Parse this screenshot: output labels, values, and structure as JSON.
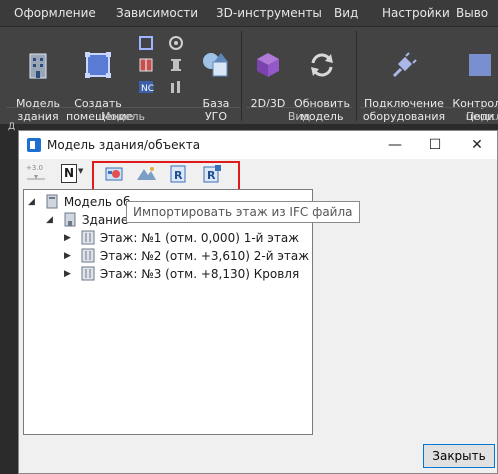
{
  "menu": [
    "Оформление",
    "Зависимости",
    "3D-инструменты",
    "Вид",
    "Настройки",
    "Выво"
  ],
  "ribbon": {
    "model_building": "Модель\nздания",
    "create_room": "Создать\nпомещение",
    "base_ugo": "База\nУГО",
    "view_2d3d": "2D/3D",
    "refresh_model": "Обновить\nмодель",
    "connect_equipment": "Подключение\nоборудования",
    "control_points": "Контроль\nцепи",
    "group_model": "Модель",
    "group_view": "Вид",
    "group_conn": "Подкл",
    "tab_left_glyph": "Д"
  },
  "dialog": {
    "title": "Модель здания/объекта",
    "minimize": "—",
    "maximize": "☐",
    "close": "✕",
    "close_button": "Закрыть",
    "tooltip": "Импортировать этаж из IFC файла",
    "tree": {
      "root": "Модель об",
      "building": "Здание",
      "floors": [
        "Этаж: №1 (отм. 0,000) 1-й этаж",
        "Этаж: №2 (отм. +3,610) 2-й этаж",
        "Этаж: №3 (отм. +8,130) Кровля"
      ]
    },
    "toolbar": {
      "elev_label": "+3.0",
      "n_label": "N"
    }
  },
  "colors": {
    "highlight": "#e0191b",
    "accent": "#0078d4"
  }
}
